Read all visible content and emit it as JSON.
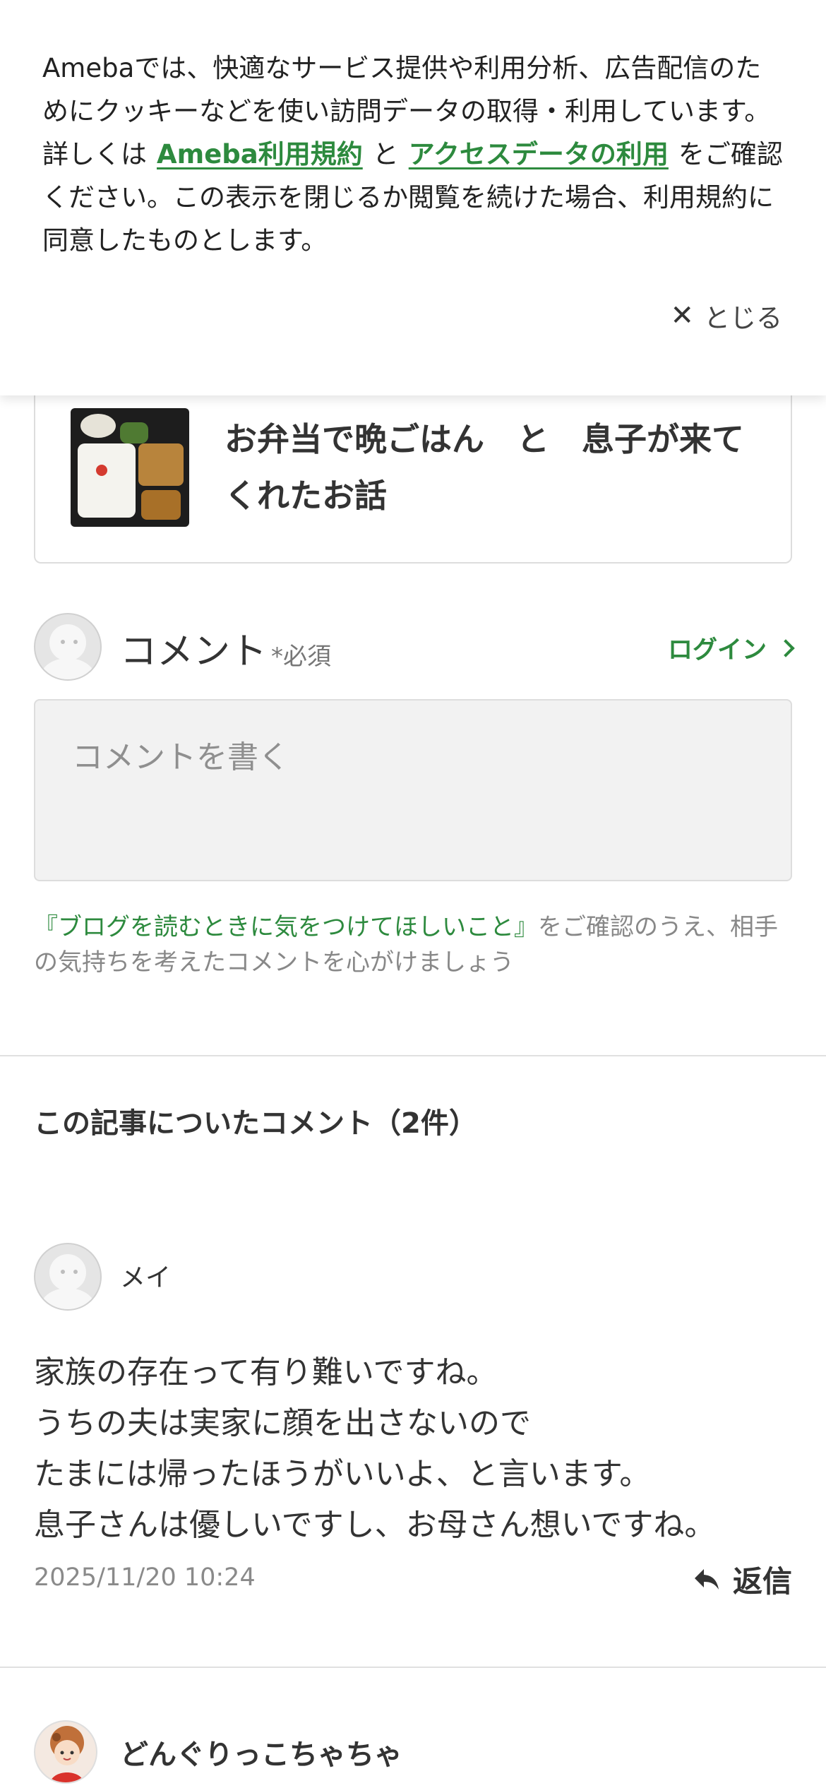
{
  "cookie_banner": {
    "text_before": "Amebaでは、快適なサービス提供や利用分析、広告配信のためにクッキーなどを使い訪問データの取得・利用しています。詳しくは",
    "link_terms": "Ameba利用規約",
    "text_and": "と",
    "link_access_data": "アクセスデータの利用",
    "text_after": "をご確認ください。この表示を閉じるか閲覧を続けた場合、利用規約に同意したものとします。",
    "close_label": "とじる"
  },
  "article": {
    "title": "お弁当で晩ごはん　と　息子が来てくれたお話"
  },
  "comment_form": {
    "label": "コメント",
    "required": "*必須",
    "login_label": "ログイン",
    "placeholder": "コメントを書く",
    "guideline_link": "『ブログを読むときに気をつけてほしいこと』",
    "guideline_rest": "をご確認のうえ、相手の気持ちを考えたコメントを心がけましょう"
  },
  "comments_section": {
    "title": "この記事についたコメント（2件）"
  },
  "comments": [
    {
      "name": "メイ",
      "body": "家族の存在って有り難いですね。\nうちの夫は実家に顔を出さないので\nたまには帰ったほうがいいよ、と言います。\n息子さんは優しいですし、お母さん想いですね。",
      "time": "2025/11/20 10:24",
      "reply_label": "返信"
    },
    {
      "name": "どんぐりっこちゃちゃ"
    }
  ],
  "colors": {
    "accent": "#2d8a3e",
    "text": "#333333",
    "muted": "#888888"
  }
}
